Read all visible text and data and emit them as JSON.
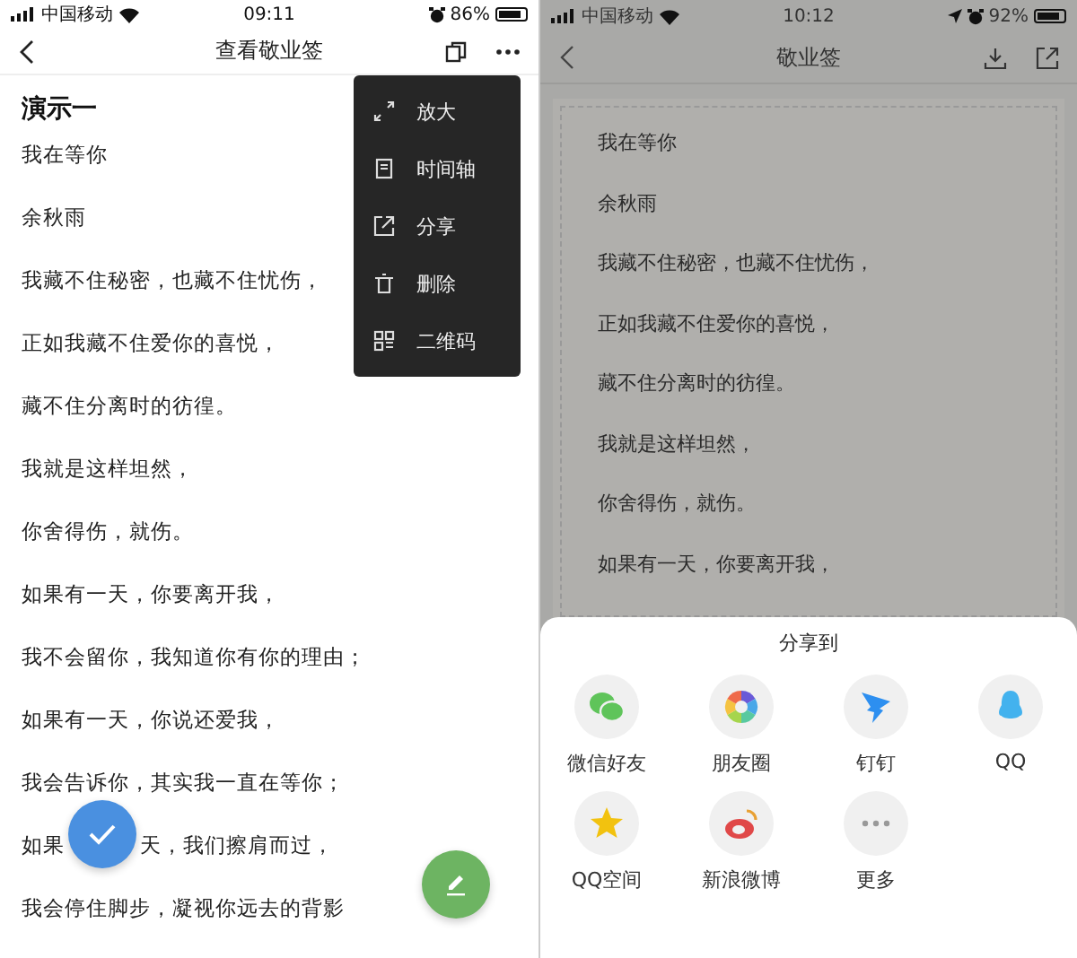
{
  "left": {
    "status": {
      "carrier": "中国移动",
      "time": "09:11",
      "battery": "86%"
    },
    "nav": {
      "title": "查看敬业签"
    },
    "menu": [
      {
        "label": "放大"
      },
      {
        "label": "时间轴"
      },
      {
        "label": "分享"
      },
      {
        "label": "删除"
      },
      {
        "label": "二维码"
      }
    ],
    "note": {
      "title": "演示一",
      "lines": [
        "我在等你",
        "余秋雨",
        "我藏不住秘密，也藏不住忧伤，",
        "正如我藏不住爱你的喜悦，",
        "藏不住分离时的彷徨。",
        "我就是这样坦然，",
        "你舍得伤，就伤。",
        "如果有一天，你要离开我，",
        "我不会留你，我知道你有你的理由；",
        "如果有一天，你说还爱我，",
        "我会告诉你，其实我一直在等你；",
        [
          "如果",
          "天，我们擦肩而过，"
        ],
        "我会停住脚步，凝视你远去的背影"
      ]
    }
  },
  "right": {
    "status": {
      "carrier": "中国移动",
      "time": "10:12",
      "battery": "92%"
    },
    "nav": {
      "title": "敬业签"
    },
    "note": {
      "lines": [
        "我在等你",
        "余秋雨",
        "我藏不住秘密，也藏不住忧伤，",
        "正如我藏不住爱你的喜悦，",
        "藏不住分离时的彷徨。",
        "我就是这样坦然，",
        "你舍得伤，就伤。",
        "如果有一天，你要离开我，"
      ]
    },
    "share": {
      "title": "分享到",
      "items": [
        {
          "label": "微信好友"
        },
        {
          "label": "朋友圈"
        },
        {
          "label": "钉钉"
        },
        {
          "label": "QQ"
        },
        {
          "label": "QQ空间"
        },
        {
          "label": "新浪微博"
        },
        {
          "label": "更多"
        }
      ]
    }
  }
}
